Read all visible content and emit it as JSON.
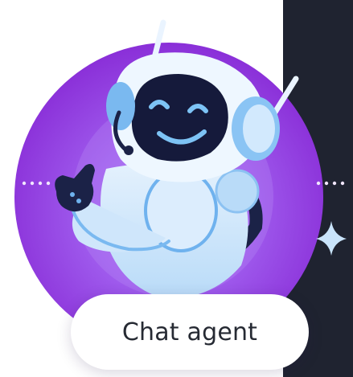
{
  "avatar": {
    "icon": "robot-icon",
    "colors": {
      "circle_outer": "#8b2fd9",
      "circle_inner": "#a56cf0",
      "robot_body": "#cfe6fb",
      "robot_accent": "#5aa8ee",
      "robot_face": "#151a3b",
      "dark_panel": "#1f2330"
    }
  },
  "chat_button": {
    "label": "Chat agent"
  }
}
